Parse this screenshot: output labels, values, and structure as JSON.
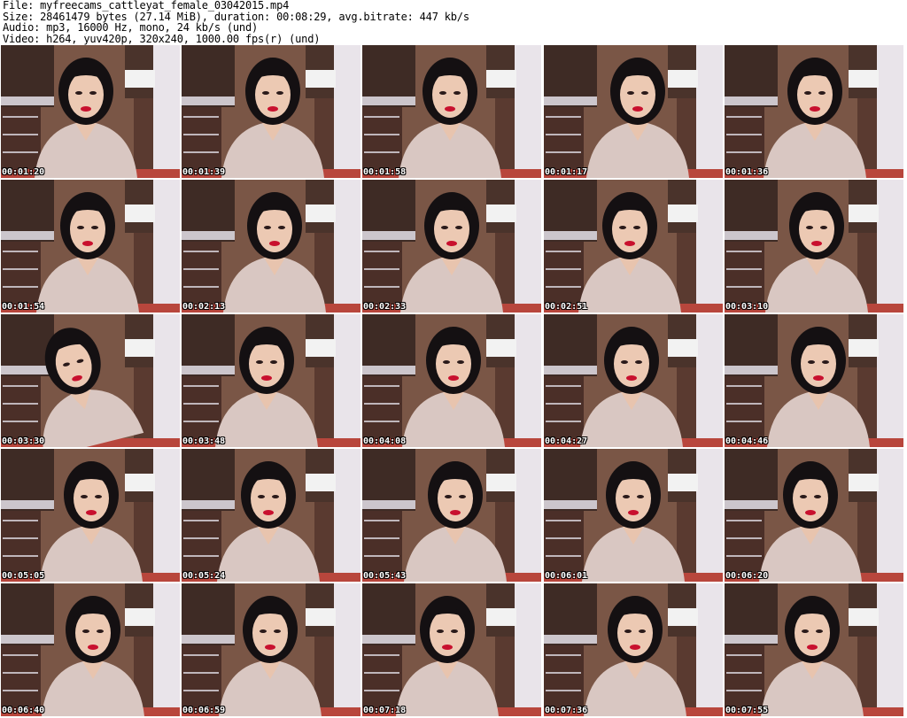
{
  "header": {
    "file_line": "File: myfreecams_cattleyat_female_03042015.mp4",
    "size_line": "Size: 28461479 bytes (27.14 MiB), duration: 00:08:29, avg.bitrate: 447 kb/s",
    "audio_line": "Audio: mp3, 16000 Hz, mono, 24 kb/s (und)",
    "video_line": "Video: h264, yuv420p, 320x240, 1000.00 fps(r) (und)"
  },
  "thumbnails": [
    {
      "timestamp": "00:01:20"
    },
    {
      "timestamp": "00:01:39"
    },
    {
      "timestamp": "00:01:58"
    },
    {
      "timestamp": "00:01:17"
    },
    {
      "timestamp": "00:01:36"
    },
    {
      "timestamp": "00:01:54"
    },
    {
      "timestamp": "00:02:13"
    },
    {
      "timestamp": "00:02:33"
    },
    {
      "timestamp": "00:02:51"
    },
    {
      "timestamp": "00:03:10"
    },
    {
      "timestamp": "00:03:30"
    },
    {
      "timestamp": "00:03:48"
    },
    {
      "timestamp": "00:04:08"
    },
    {
      "timestamp": "00:04:27"
    },
    {
      "timestamp": "00:04:46"
    },
    {
      "timestamp": "00:05:05"
    },
    {
      "timestamp": "00:05:24"
    },
    {
      "timestamp": "00:05:43"
    },
    {
      "timestamp": "00:06:01"
    },
    {
      "timestamp": "00:06:20"
    },
    {
      "timestamp": "00:06:40"
    },
    {
      "timestamp": "00:06:59"
    },
    {
      "timestamp": "00:07:18"
    },
    {
      "timestamp": "00:07:36"
    },
    {
      "timestamp": "00:07:55"
    }
  ]
}
